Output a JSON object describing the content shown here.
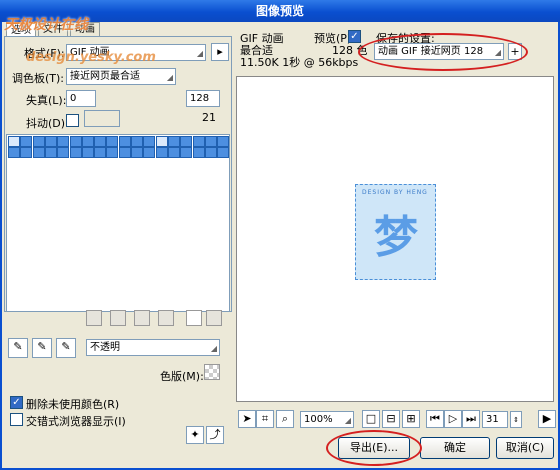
{
  "window": {
    "title": "图像预览"
  },
  "watermark": {
    "line1": "天极设计在线",
    "line2": "design.yesky.com"
  },
  "tabs": [
    {
      "label": "选项"
    },
    {
      "label": "文件"
    },
    {
      "label": "动画"
    }
  ],
  "options": {
    "format_label": "格式(F):",
    "format_value": "GIF 动画",
    "palette_label": "调色板(T):",
    "palette_value": "接近网页最合适",
    "loss_label": "失真(L):",
    "loss_value": "0",
    "colors_value": "128",
    "dither_label": "抖动(D):",
    "count_value": "21"
  },
  "matte": {
    "value": "不透明",
    "label": "色版(M):"
  },
  "checks": {
    "remove_unused": {
      "label": "删除未使用颜色(R)",
      "checked": true
    },
    "interlaced": {
      "label": "交错式浏览器显示(I)",
      "checked": false
    }
  },
  "info": {
    "type": "GIF 动画",
    "palette": "最合适",
    "colors": "128 色",
    "size": "11.50K 1秒 @ 56kbps",
    "preview_label": "预览(P)",
    "preview_checked": true
  },
  "saved_settings": {
    "label": "保存的设置:",
    "value": "动画 GIF 接近网页 128"
  },
  "artwork": {
    "text": "DESIGN BY HENG",
    "glyph": "梦"
  },
  "zoom": {
    "value": "100%"
  },
  "frame": {
    "value": "31"
  },
  "buttons": {
    "export": "导出(E)...",
    "ok": "确定",
    "cancel": "取消(C)"
  },
  "colors": {
    "accent": "#0a4fd0",
    "highlight": "#d42020",
    "swatch": "#4d8fe0"
  }
}
